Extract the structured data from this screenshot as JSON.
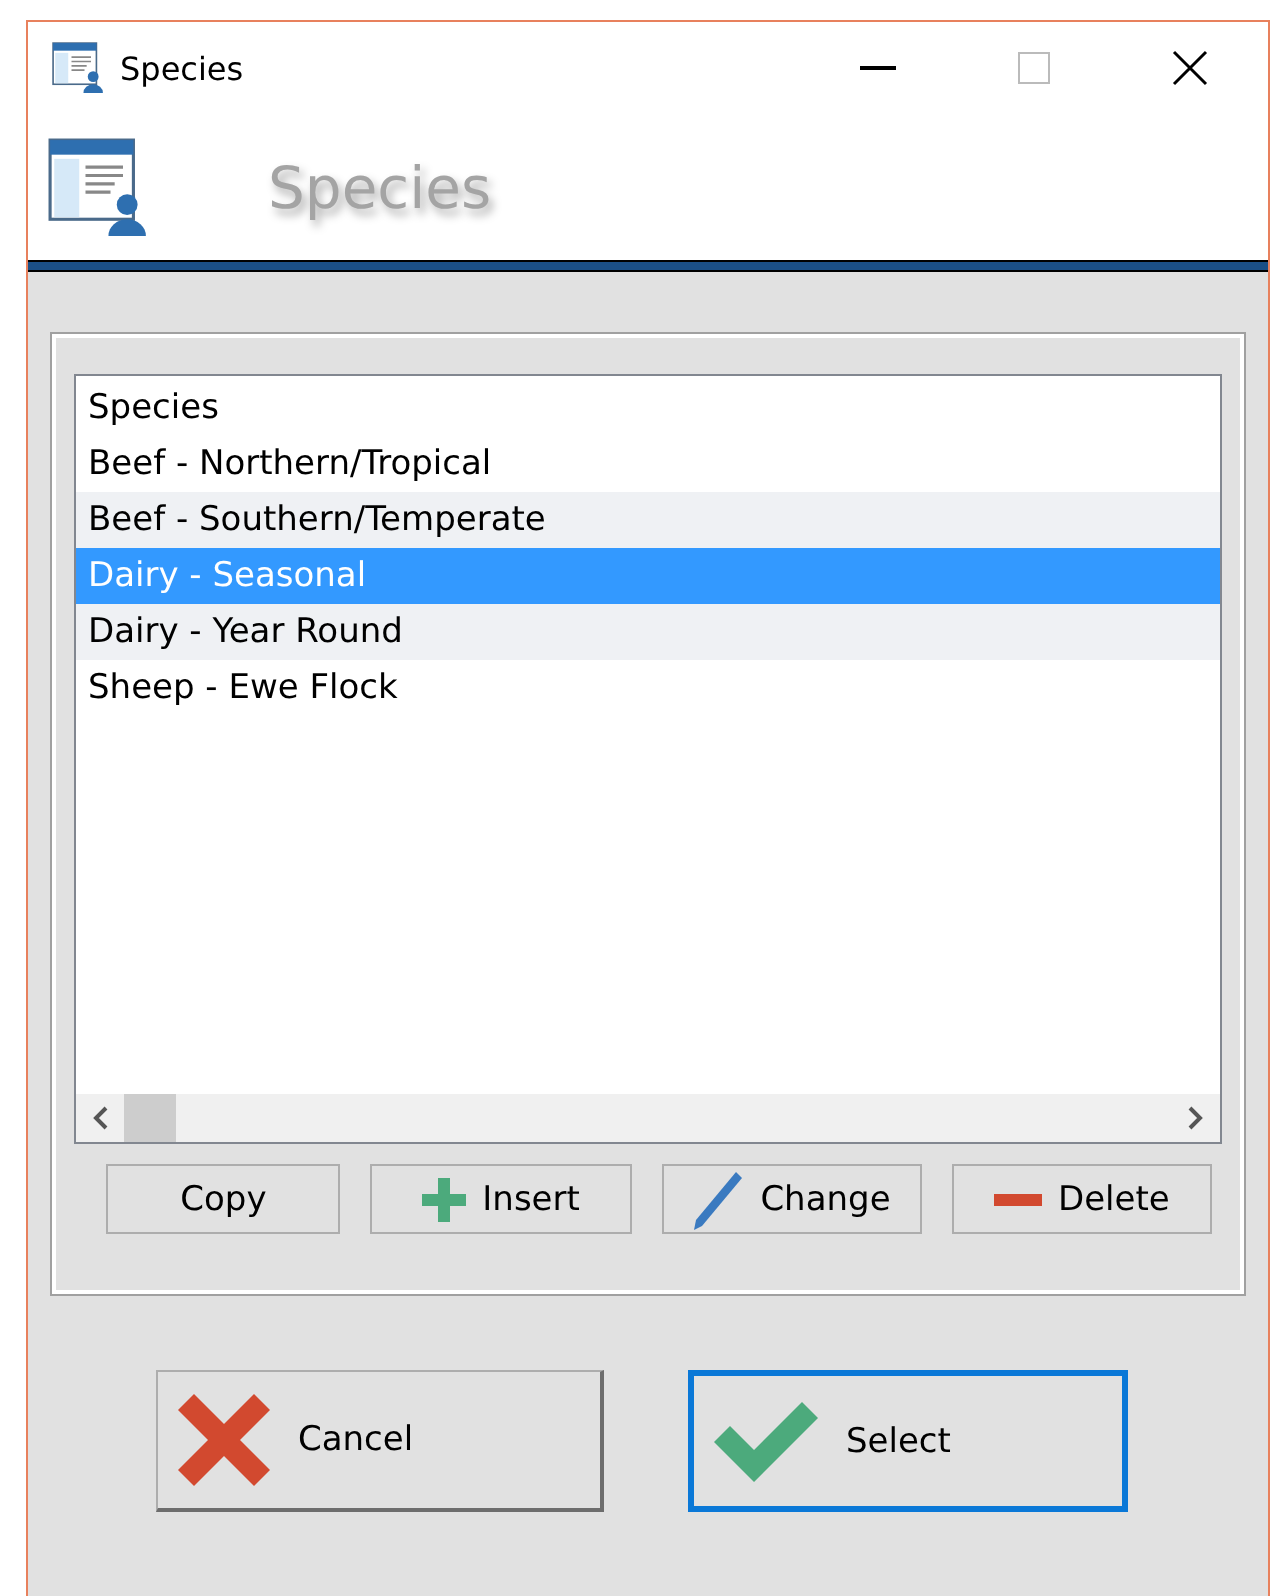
{
  "window": {
    "title": "Species"
  },
  "header": {
    "title": "Species"
  },
  "list": {
    "column": "Species",
    "rows": [
      {
        "label": "Beef - Northern/Tropical",
        "selected": false
      },
      {
        "label": "Beef - Southern/Temperate",
        "selected": false
      },
      {
        "label": "Dairy - Seasonal",
        "selected": true
      },
      {
        "label": "Dairy - Year Round",
        "selected": false
      },
      {
        "label": "Sheep - Ewe Flock",
        "selected": false
      }
    ]
  },
  "list_buttons": [
    {
      "label": "Copy",
      "kind": "plain"
    },
    {
      "label": "Insert",
      "kind": "plus"
    },
    {
      "label": "Change",
      "kind": "pencil"
    },
    {
      "label": "Delete",
      "kind": "minus"
    }
  ],
  "dialog_buttons": [
    {
      "label": "Cancel",
      "kind": "cross",
      "focused": false
    },
    {
      "label": "Select",
      "kind": "check",
      "focused": true
    }
  ]
}
